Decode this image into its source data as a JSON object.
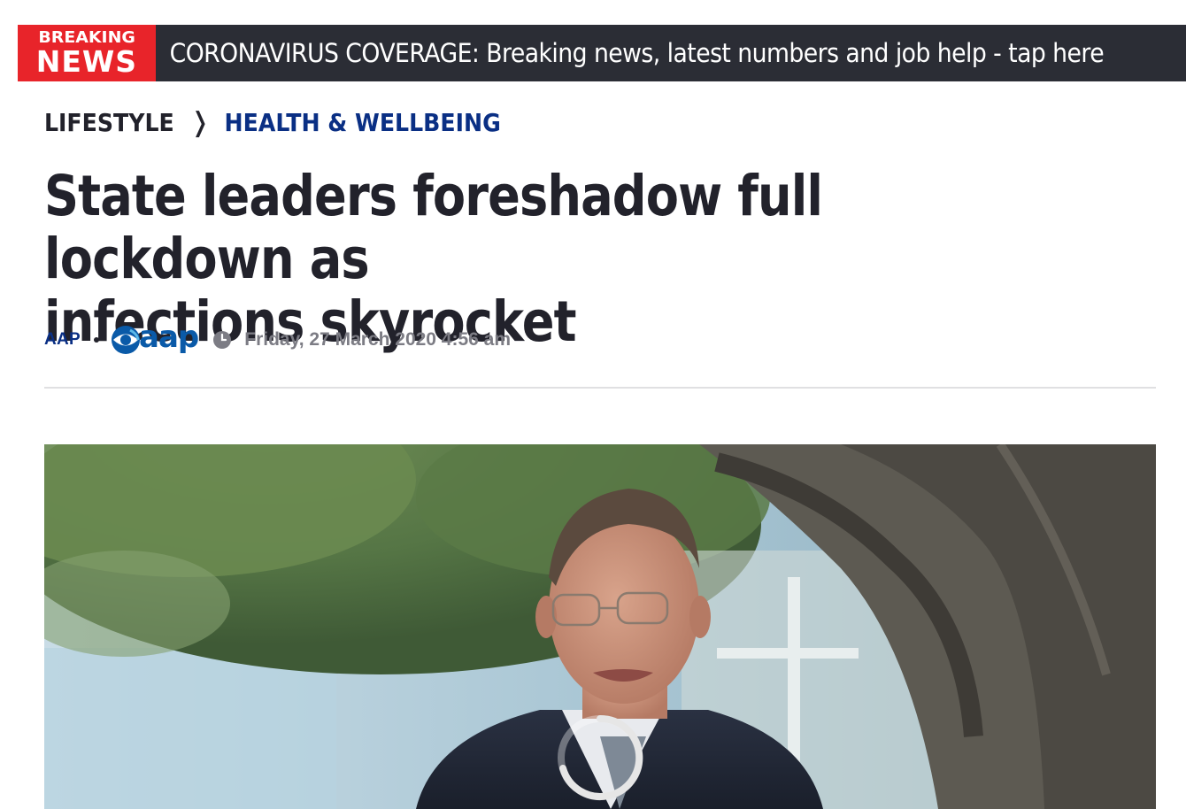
{
  "breaking": {
    "badge_line1": "BREAKING",
    "badge_line2": "NEWS",
    "text": "CORONAVIRUS COVERAGE: Breaking news, latest numbers and job help - tap here",
    "badge_color": "#e8242a",
    "bar_color": "#2b2d35"
  },
  "breadcrumb": {
    "section": "LIFESTYLE",
    "separator_icon": "chevron-right-icon",
    "subsection": "HEALTH & WELLBEING"
  },
  "article": {
    "headline_line1": "State leaders foreshadow full lockdown as",
    "headline_line2": "infections skyrocket",
    "author": "AAP",
    "source_logo_text": "aap",
    "date": "Friday, 27 March 2020 4:56 am"
  },
  "video": {
    "state": "loading",
    "spinner_icon": "loading-spinner-icon"
  },
  "colors": {
    "accent_blue": "#0a2f84",
    "text_dark": "#22222b",
    "meta_gray": "#7c7c84"
  }
}
